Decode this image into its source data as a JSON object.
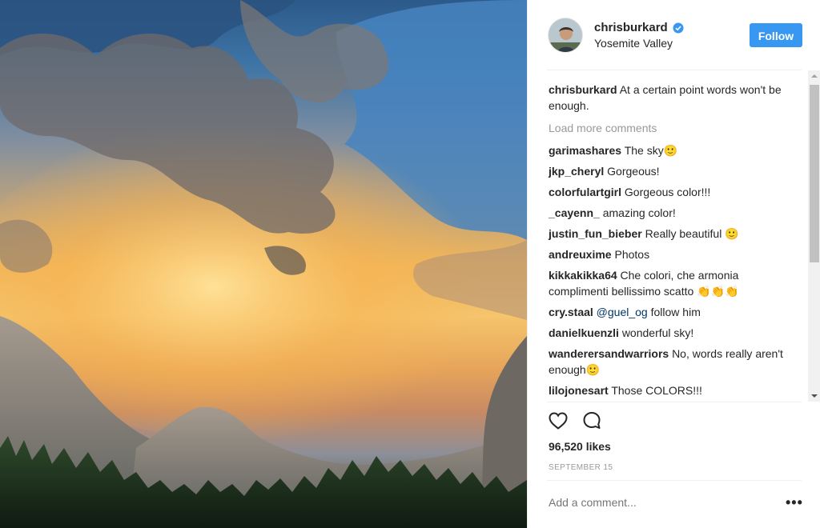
{
  "post": {
    "username": "chrisburkard",
    "location": "Yosemite Valley",
    "follow_label": "Follow",
    "caption_text": "At a certain point words won't be enough.",
    "load_more": "Load more comments",
    "likes": "96,520 likes",
    "date": "SEPTEMBER 15",
    "add_comment_placeholder": "Add a comment...",
    "more_label": "•••"
  },
  "comments": [
    {
      "user": "garimashares",
      "text": "The sky🙂"
    },
    {
      "user": "jkp_cheryl",
      "text": "Gorgeous!"
    },
    {
      "user": "colorfulartgirl",
      "text": "Gorgeous color!!!"
    },
    {
      "user": "_cayenn_",
      "text": "amazing color!"
    },
    {
      "user": "justin_fun_bieber",
      "text": "Really beautiful 🙂"
    },
    {
      "user": "andreuxime",
      "text": "Photos"
    },
    {
      "user": "kikkakikka64",
      "text": "Che colori, che armonia complimenti bellissimo scatto 👏👏👏"
    },
    {
      "user": "cry.staal",
      "mention": "@guel_og",
      "text": "follow him"
    },
    {
      "user": "danielkuenzli",
      "text": "wonderful sky!"
    },
    {
      "user": "wanderersandwarriors",
      "text": "No, words really aren't enough🙂"
    },
    {
      "user": "lilojonesart",
      "text": "Those COLORS!!!"
    }
  ],
  "icons": {
    "like": "heart-icon",
    "comment": "comment-bubble-icon",
    "verified": "verified-badge-icon"
  },
  "colors": {
    "accent": "#3897f0",
    "text": "#262626",
    "muted": "#999999",
    "mention": "#003569"
  }
}
